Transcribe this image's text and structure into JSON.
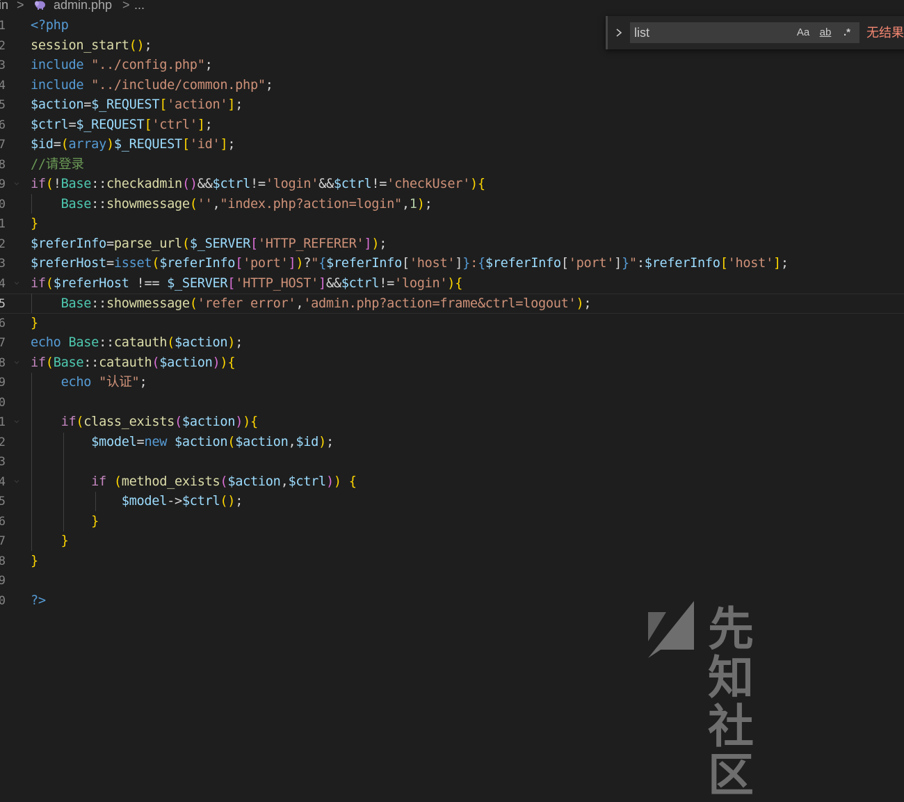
{
  "breadcrumb": {
    "segment_prefix": "in",
    "separator": ">",
    "file_icon": "php-elephant-icon",
    "file_name": "admin.php",
    "trailing": "..."
  },
  "find_widget": {
    "query": "list",
    "match_case_label": "Aa",
    "whole_word_label": "ab",
    "regex_label": ".*",
    "status": "无结果"
  },
  "editor": {
    "language": "php",
    "line_number_digits": [
      "1",
      "2",
      "3",
      "4",
      "5",
      "6",
      "7",
      "8",
      "9",
      "0",
      "1",
      "2",
      "3",
      "4",
      "5",
      "6",
      "7",
      "8",
      "9",
      "0",
      "1",
      "2",
      "3",
      "4",
      "5",
      "6",
      "7",
      "8",
      "9",
      "0"
    ],
    "active_line_index": 14,
    "lines": [
      "<?php",
      "session_start();",
      "include \"../config.php\";",
      "include \"../include/common.php\";",
      "$action=$_REQUEST['action'];",
      "$ctrl=$_REQUEST['ctrl'];",
      "$id=(array)$_REQUEST['id'];",
      "//请登录",
      "if(!Base::checkadmin()&&$ctrl!='login'&&$ctrl!='checkUser'){",
      "    Base::showmessage('',\"index.php?action=login\",1);",
      "}",
      "$referInfo=parse_url($_SERVER['HTTP_REFERER']);",
      "$referHost=isset($referInfo['port'])?\"{$referInfo['host']}:{$referInfo['port']}\":$referInfo['host'];",
      "if($referHost !== $_SERVER['HTTP_HOST']&&$ctrl!='login'){",
      "    Base::showmessage('refer error','admin.php?action=frame&ctrl=logout');",
      "}",
      "echo Base::catauth($action);",
      "if(Base::catauth($action)){",
      "    echo \"认证\";",
      "",
      "    if(class_exists($action)){",
      "        $model=new $action($action,$id);",
      "",
      "        if (method_exists($action,$ctrl)) {",
      "            $model->$ctrl();",
      "        }",
      "    }",
      "}",
      "",
      "?>"
    ]
  },
  "watermark": {
    "text": "先知社区",
    "logo_icon": "xianzhi-logo-icon"
  },
  "colors": {
    "background": "#1e1e1e",
    "keyword": "#569cd6",
    "control": "#c586c0",
    "function": "#dcdcaa",
    "variable": "#9cdcfe",
    "string": "#ce9178",
    "class": "#4ec9b0",
    "comment": "#6a9955",
    "find_status": "#f48771"
  }
}
